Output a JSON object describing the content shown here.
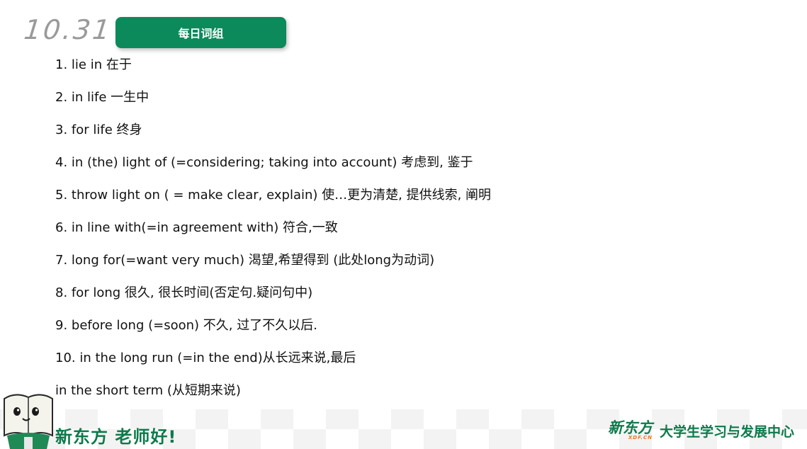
{
  "header": {
    "date": "10.31",
    "title": "每日词组"
  },
  "phrases": [
    "1. lie in 在于",
    "2. in life 一生中",
    "3. for life 终身",
    "4. in (the) light of (=considering; taking into account) 考虑到, 鉴于",
    "5. throw light on ( = make clear, explain) 使…更为清楚, 提供线索, 阐明",
    "6. in line with(=in agreement with) 符合,一致",
    "7. long for(=want very much) 渴望,希望得到 (此处long为动词)",
    "8. for long 很久, 很长时间(否定句.疑问句中)",
    "9. before long (=soon) 不久, 过了不久以后.",
    "10. in the long run (=in the end)从长远来说,最后",
    "in the short term (从短期来说)"
  ],
  "footer": {
    "slogan": "新东方 老师好!",
    "logo_text": "新东方",
    "logo_sub": "XDF.CN",
    "department": "大学生学习与发展中心",
    "mascot_icon": "book-mascot-icon"
  },
  "colors": {
    "brand_green": "#0c8a5b",
    "footer_green": "#0d7a4b",
    "date_gray": "#9a9a9a"
  }
}
